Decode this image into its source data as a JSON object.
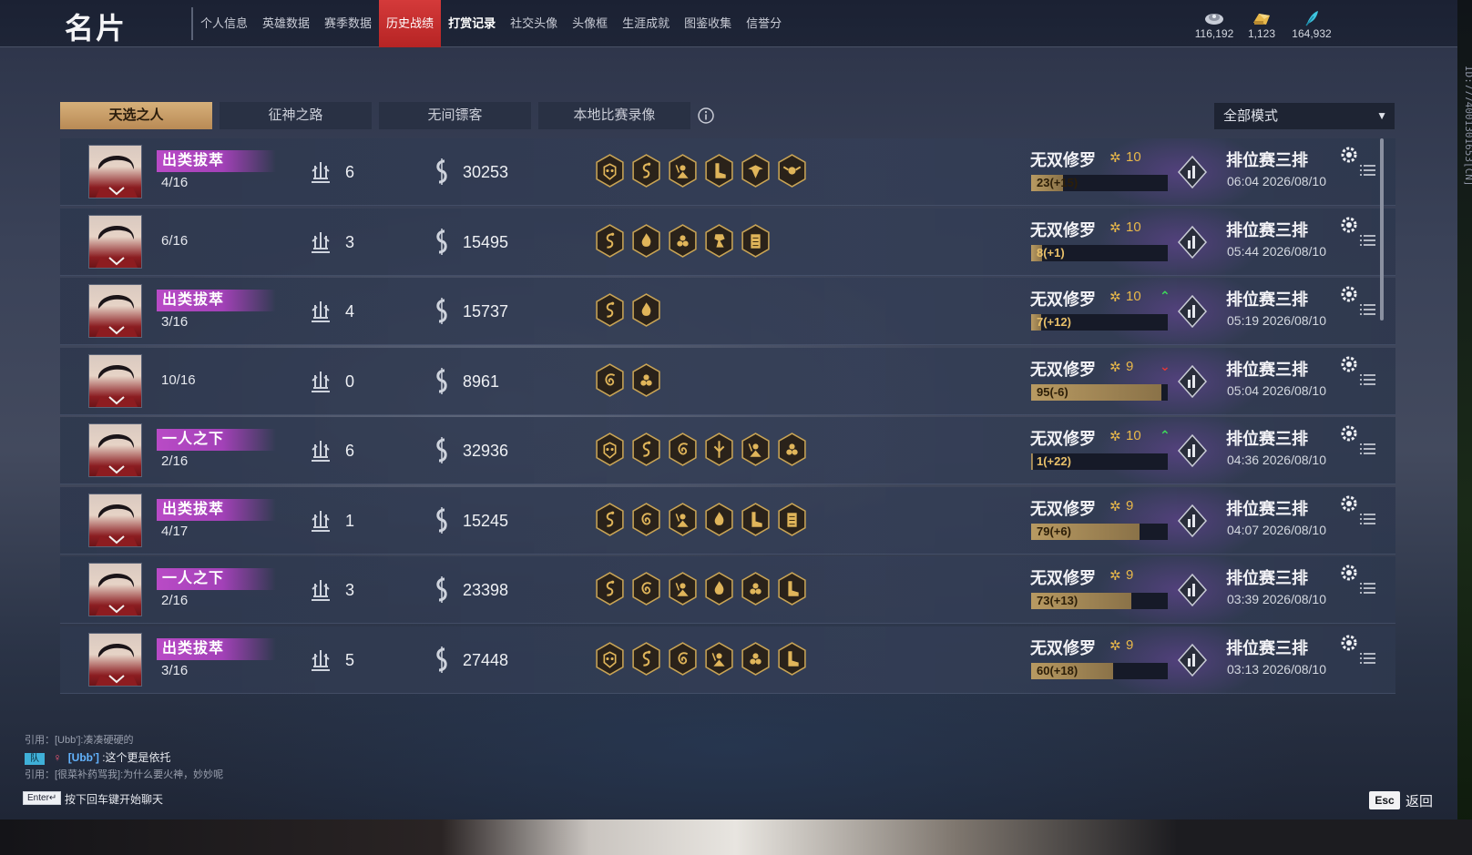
{
  "header": {
    "title": "名片",
    "tabs": [
      "个人信息",
      "英雄数据",
      "赛季数据",
      "历史战绩",
      "打赏记录",
      "社交头像",
      "头像框",
      "生涯成就",
      "图鉴收集",
      "信誉分"
    ],
    "active_tab": "历史战绩",
    "currencies": [
      {
        "icon": "gold-ingot-icon",
        "value": "116,192",
        "color": "#c8cdd8"
      },
      {
        "icon": "gem-pile-icon",
        "value": "1,123",
        "color": "#e8b84a"
      },
      {
        "icon": "feather-icon",
        "value": "164,932",
        "color": "#3fc6e0"
      }
    ],
    "player_id": "ID:7774001301653[CN]"
  },
  "subtabs": [
    "天选之人",
    "征神之路",
    "无间镖客",
    "本地比赛录像"
  ],
  "active_subtab": "天选之人",
  "mode_filter": {
    "selected": "全部模式"
  },
  "matches": [
    {
      "badge": "出类拔萃",
      "rank": "4/16",
      "kills": "6",
      "score": "30253",
      "medals": [
        "demon-mask-icon",
        "serpent-icon",
        "warrior-icon",
        "boot-icon",
        "eagle-icon",
        "winged-skull-icon"
      ],
      "tier": "无双修罗",
      "level": "10",
      "trend": "",
      "progress_text": "23(+15)",
      "progress": 0.23,
      "mode": "排位赛三排",
      "time": "06:04 2026/08/10"
    },
    {
      "badge": "",
      "rank": "6/16",
      "kills": "3",
      "score": "15495",
      "medals": [
        "serpent-icon",
        "flame-icon",
        "cluster-icon",
        "dragon-icon",
        "scroll-icon"
      ],
      "tier": "无双修罗",
      "level": "10",
      "trend": "",
      "progress_text": "8(+1)",
      "progress": 0.08,
      "mode": "排位赛三排",
      "time": "05:44 2026/08/10"
    },
    {
      "badge": "出类拔萃",
      "rank": "3/16",
      "kills": "4",
      "score": "15737",
      "medals": [
        "serpent-icon",
        "flame-icon"
      ],
      "tier": "无双修罗",
      "level": "10",
      "trend": "up",
      "progress_text": "7(+12)",
      "progress": 0.07,
      "mode": "排位赛三排",
      "time": "05:19 2026/08/10"
    },
    {
      "badge": "",
      "rank": "10/16",
      "kills": "0",
      "score": "8961",
      "medals": [
        "swirl-icon",
        "cluster-icon"
      ],
      "tier": "无双修罗",
      "level": "9",
      "trend": "down",
      "progress_text": "95(-6)",
      "progress": 0.95,
      "mode": "排位赛三排",
      "time": "05:04 2026/08/10"
    },
    {
      "badge": "一人之下",
      "rank": "2/16",
      "kills": "6",
      "score": "32936",
      "medals": [
        "demon-mask-icon",
        "serpent-icon",
        "swirl-icon",
        "spear-icon",
        "warrior-icon",
        "cluster-icon"
      ],
      "tier": "无双修罗",
      "level": "10",
      "trend": "up",
      "progress_text": "1(+22)",
      "progress": 0.01,
      "mode": "排位赛三排",
      "time": "04:36 2026/08/10"
    },
    {
      "badge": "出类拔萃",
      "rank": "4/17",
      "kills": "1",
      "score": "15245",
      "medals": [
        "serpent-icon",
        "swirl-icon",
        "warrior-icon",
        "flame-icon",
        "boot-icon",
        "scroll-icon"
      ],
      "tier": "无双修罗",
      "level": "9",
      "trend": "",
      "progress_text": "79(+6)",
      "progress": 0.79,
      "mode": "排位赛三排",
      "time": "04:07 2026/08/10"
    },
    {
      "badge": "一人之下",
      "rank": "2/16",
      "kills": "3",
      "score": "23398",
      "medals": [
        "serpent-icon",
        "swirl-icon",
        "warrior-icon",
        "flame-icon",
        "cluster-icon",
        "boot-icon"
      ],
      "tier": "无双修罗",
      "level": "9",
      "trend": "",
      "progress_text": "73(+13)",
      "progress": 0.73,
      "mode": "排位赛三排",
      "time": "03:39 2026/08/10"
    },
    {
      "badge": "出类拔萃",
      "rank": "3/16",
      "kills": "5",
      "score": "27448",
      "medals": [
        "demon-mask-icon",
        "serpent-icon",
        "swirl-icon",
        "warrior-icon",
        "cluster-icon",
        "boot-icon"
      ],
      "tier": "无双修罗",
      "level": "9",
      "trend": "",
      "progress_text": "60(+18)",
      "progress": 0.6,
      "mode": "排位赛三排",
      "time": "03:13 2026/08/10"
    }
  ],
  "chat": {
    "quote1": "引用：[Ubb']:凑凑硬硬的",
    "channel_tag": "队",
    "sender": "[Ubb']",
    "message": ":这个更是依托",
    "quote2": "引用：[很菜补药骂我]:为什么要火神，妙妙呢",
    "enter_key": "Enter↵",
    "enter_hint": "按下回车键开始聊天"
  },
  "footer": {
    "esc_key": "Esc",
    "esc_label": "返回"
  },
  "colors": {
    "accent_red": "#c62f2f",
    "badge_purple": "#b94bc6",
    "gold": "#e8b84a",
    "trend_up": "#3ddc5a",
    "trend_down": "#e03838"
  }
}
